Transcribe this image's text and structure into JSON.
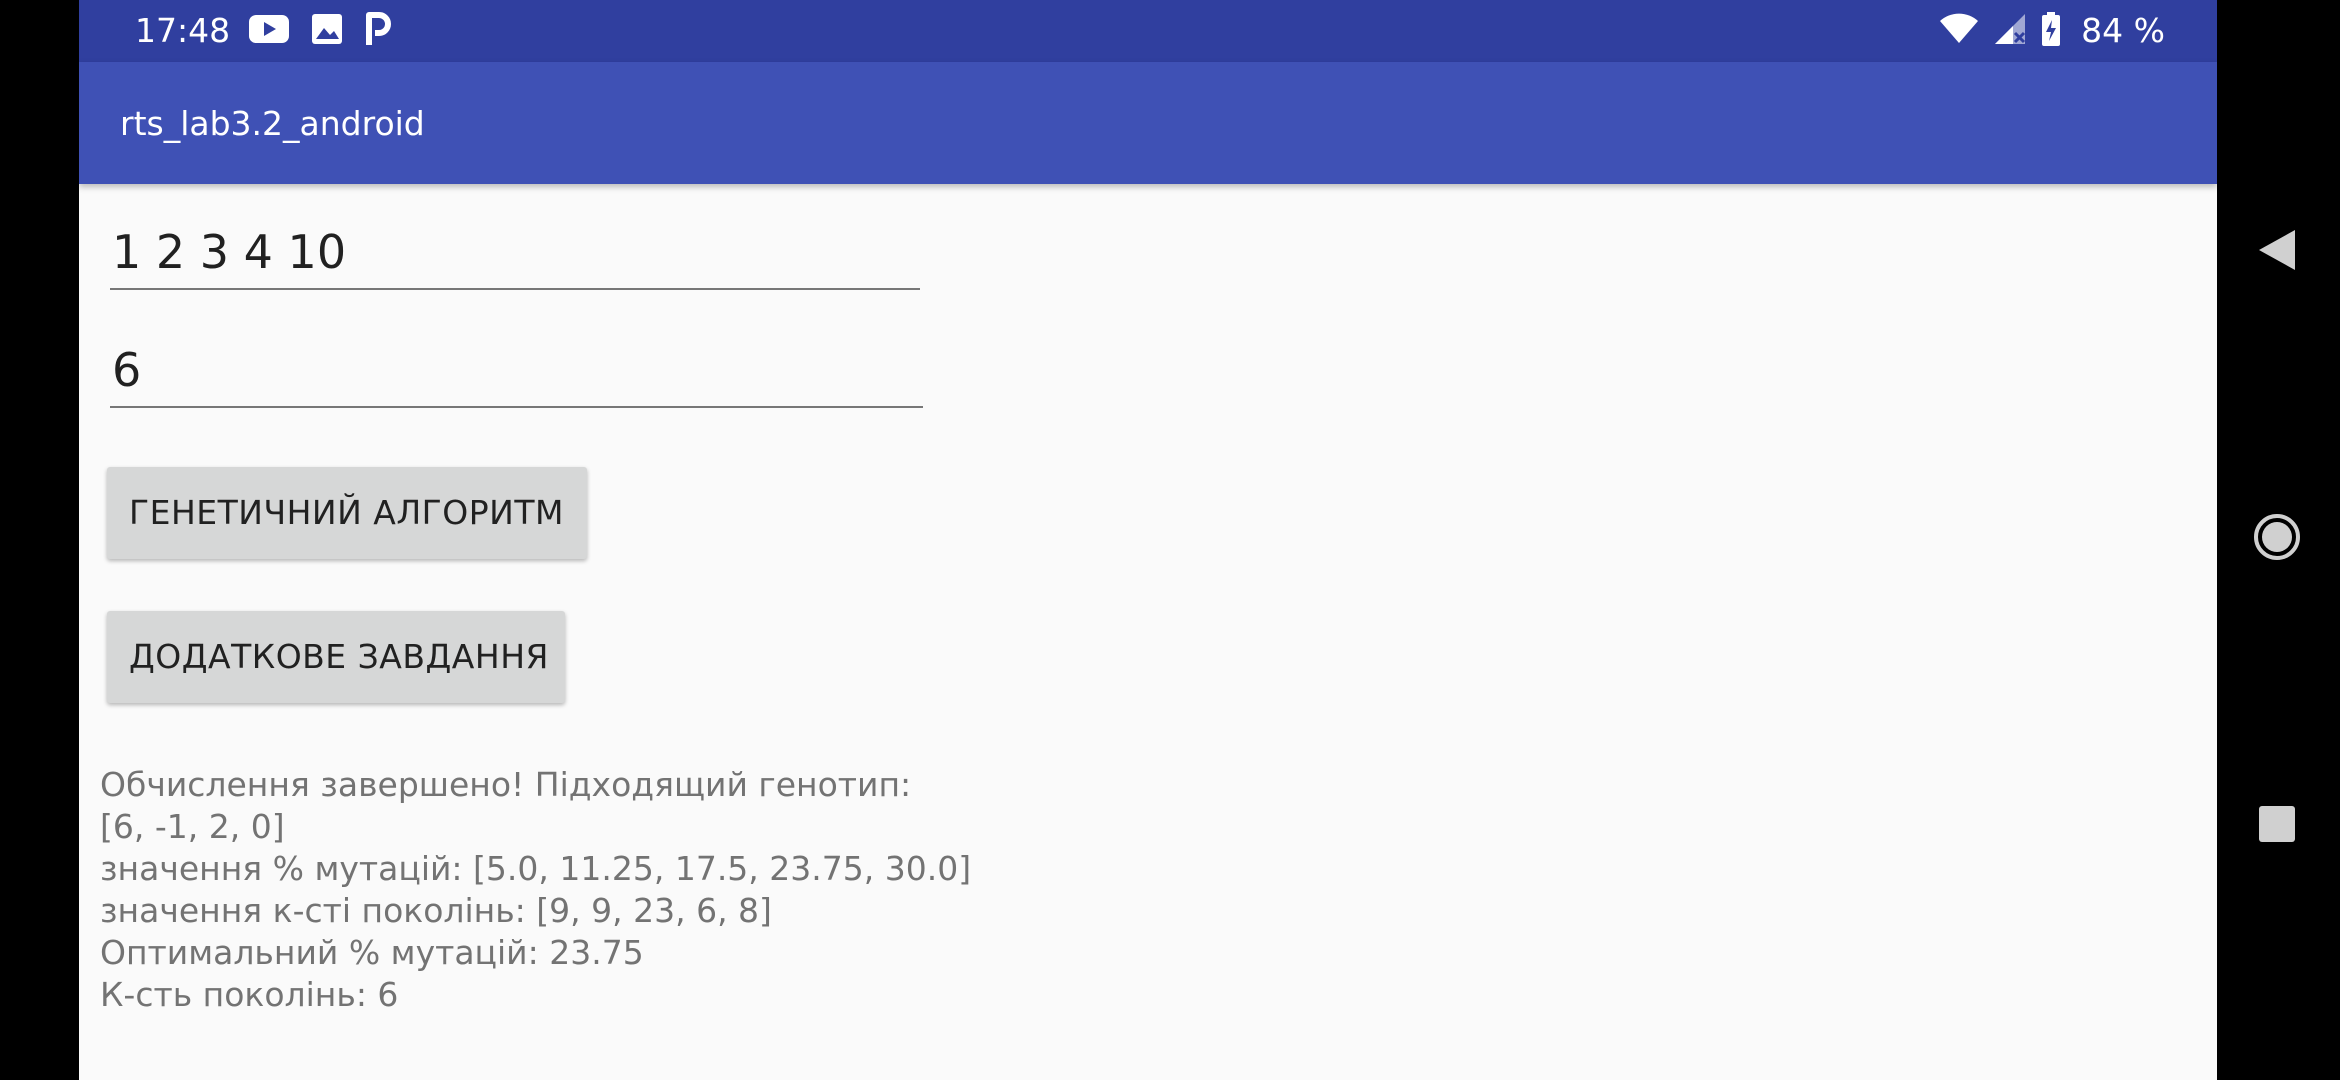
{
  "status_bar": {
    "time": "17:48",
    "left_icons": [
      "youtube-icon",
      "image-icon",
      "p-icon"
    ],
    "right_icons": [
      "wifi-icon",
      "signal-icon",
      "battery-icon"
    ],
    "battery_percent": "84 %"
  },
  "app_bar": {
    "title": "rts_lab3.2_android"
  },
  "inputs": {
    "numbers_value": "1 2 3 4 10",
    "target_value": "6"
  },
  "buttons": {
    "genetic_algorithm_label": "ГЕНЕТИЧНИЙ АЛГОРИТМ",
    "additional_task_label": "ДОДАТКОВЕ ЗАВДАННЯ"
  },
  "result": {
    "lines": [
      "Обчислення завершено! Підходящий генотип:",
      "[6, -1, 2, 0]",
      "значення % мутацій: [5.0, 11.25, 17.5, 23.75, 30.0]",
      "значення к-сті поколінь: [9, 9, 23, 6, 8]",
      "Оптимальний % мутацій: 23.75",
      "К-сть поколінь: 6"
    ]
  },
  "navigation": {
    "icons": [
      "back-icon",
      "home-icon",
      "recents-icon"
    ]
  },
  "colors": {
    "status_bar": "#303f9f",
    "app_bar": "#3f51b5",
    "background": "#fafafa",
    "button": "#d6d7d7",
    "result_text": "#737373"
  }
}
